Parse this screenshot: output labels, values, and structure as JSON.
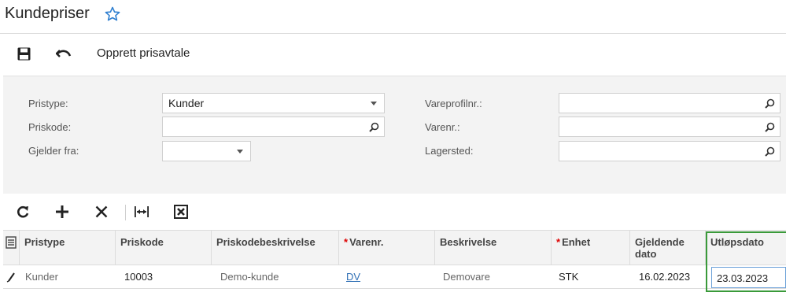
{
  "header": {
    "title": "Kundepriser",
    "favorite_icon": "star-outline-icon"
  },
  "toolbar": {
    "save_icon": "save-icon",
    "undo_icon": "undo-icon",
    "create_label": "Opprett prisavtale"
  },
  "form": {
    "pristype_label": "Pristype:",
    "pristype_value": "Kunder",
    "priskode_label": "Priskode:",
    "priskode_value": "",
    "gjelder_label": "Gjelder fra:",
    "gjelder_value": "",
    "vareprofil_label": "Vareprofilnr.:",
    "vareprofil_value": "",
    "varenr_label": "Varenr.:",
    "varenr_value": "",
    "lagersted_label": "Lagersted:",
    "lagersted_value": ""
  },
  "grid_toolbar": {
    "icons": [
      "refresh-icon",
      "add-icon",
      "delete-icon",
      "fit-columns-icon",
      "excel-export-icon"
    ]
  },
  "grid": {
    "columns": {
      "pristype": "Pristype",
      "priskode": "Priskode",
      "priskodebeskrivelse": "Priskodebeskrivelse",
      "varenr": "Varenr.",
      "beskrivelse": "Beskrivelse",
      "enhet": "Enhet",
      "gjeldende_1": "Gjeldende",
      "gjeldende_2": "dato",
      "utlopsdato": "Utløpsdato"
    },
    "required_marker": "*",
    "rows": [
      {
        "pristype": "Kunder",
        "priskode": "10003",
        "priskodebeskrivelse": "Demo-kunde",
        "varenr": "DV",
        "beskrivelse": "Demovare",
        "enhet": "STK",
        "gjeldende_dato": "16.02.2023",
        "utlopsdato": "23.03.2023"
      }
    ]
  },
  "colors": {
    "accent": "#2f6fb5",
    "highlight_border": "#3a9a3a",
    "required": "#dd0000"
  }
}
